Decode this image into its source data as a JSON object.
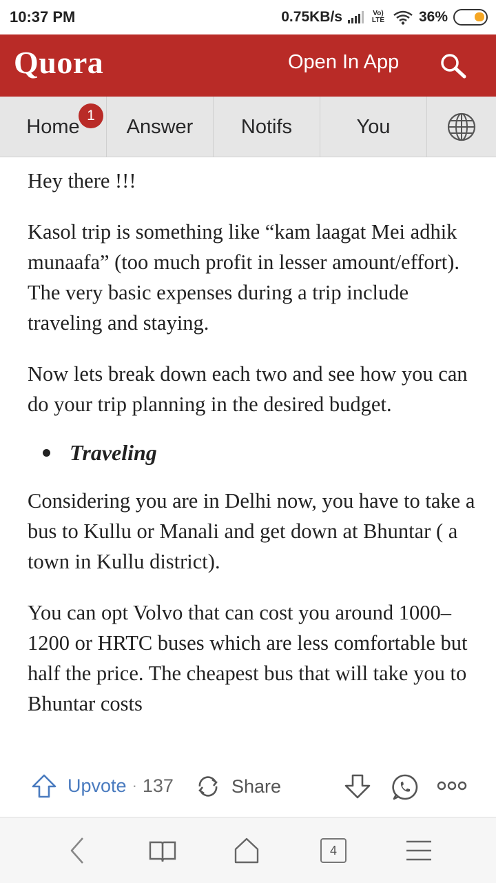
{
  "status_bar": {
    "time": "10:37 PM",
    "network_speed": "0.75KB/s",
    "lte_label": "Vo) LTE",
    "battery": "36%"
  },
  "header": {
    "logo": "Quora",
    "open_app": "Open In App",
    "search_icon": "search-icon",
    "color": "#b92b27"
  },
  "nav": {
    "tabs": [
      {
        "label": "Home",
        "badge": "1"
      },
      {
        "label": "Answer"
      },
      {
        "label": "Notifs"
      },
      {
        "label": "You"
      },
      {
        "icon": "globe-icon"
      }
    ]
  },
  "content": {
    "paragraphs": [
      "Hey there !!!",
      "Kasol trip is something like “kam laagat Mei adhik munaafa” (too much profit in lesser amount/effort). The very basic expenses during a trip include traveling and staying.",
      "Now lets break down each two and see how you can do your trip planning in the desired budget."
    ],
    "bullet": "Traveling",
    "paragraphs_after": [
      "Considering you are in Delhi now, you have to take a bus to Kullu or Manali and get down at Bhuntar ( a town in Kullu district).",
      "You can opt Volvo that can cost you around 1000–1200 or HRTC buses which are less comfortable but half the price. The cheapest bus that will take you to Bhuntar costs"
    ]
  },
  "actions": {
    "upvote_label": "Upvote",
    "separator": "·",
    "upvote_count": "137",
    "share_label": "Share",
    "upvote_color": "#4a7bbf"
  },
  "browser_bar": {
    "tab_count": "4"
  }
}
